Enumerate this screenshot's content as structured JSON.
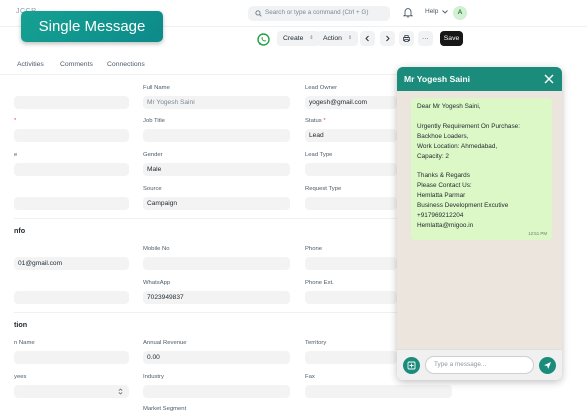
{
  "navbar": {
    "logo_text": "JCCR",
    "search_placeholder": "Search or type a command (Ctrl + G)",
    "help_label": "Help",
    "avatar_initial": "A"
  },
  "badge": {
    "label": "Single Message"
  },
  "toolbar": {
    "create_label": "Create",
    "action_label": "Action",
    "more_label": "···",
    "save_label": "Save"
  },
  "tabs": [
    "Activities",
    "Comments",
    "Connections"
  ],
  "form": {
    "row1": {
      "full_name_label": "Full Name",
      "full_name_value": "Mr Yogesh Saini",
      "lead_owner_label": "Lead Owner",
      "lead_owner_value": "yogesh@gmail.com"
    },
    "row2": {
      "left_label_tail": "*",
      "job_title_label": "Job Title",
      "status_label": "Status",
      "status_value": "Lead"
    },
    "row3": {
      "left_label_tail": "e",
      "gender_label": "Gender",
      "gender_value": "Male",
      "lead_type_label": "Lead Type"
    },
    "row4": {
      "source_label": "Source",
      "source_value": "Campaign",
      "request_type_label": "Request Type"
    },
    "contact_section": "nfo",
    "row5": {
      "email_value": "01@gmail.com",
      "mobile_label": "Mobile No",
      "phone_label": "Phone"
    },
    "row6": {
      "whatsapp_label": "WhatsApp",
      "whatsapp_value": "7023949837",
      "phone_ext_label": "Phone Ext."
    },
    "org_section": "tion",
    "row7": {
      "left_label_tail": "n Name",
      "annual_revenue_label": "Annual Revenue",
      "annual_revenue_value": "0.00",
      "territory_label": "Territory"
    },
    "row8": {
      "left_label_tail": "yees",
      "industry_label": "Industry",
      "fax_label": "Fax"
    },
    "row9": {
      "market_segment_label": "Market Segment"
    }
  },
  "chat": {
    "title": "Mr Yogesh Saini",
    "message_lines": [
      "Dear  Mr Yogesh Saini,",
      "",
      "Urgently Requirement On Purchase:",
      "Backhoe Loaders,",
      "Work Location: Ahmedabad,",
      "Capacity: 2",
      "",
      "Thanks & Regards",
      "Please Contact Us:",
      "Hemlatta Parmar",
      "Business Development Excutive",
      "+917969212204",
      "Hemlatta@migoo.in"
    ],
    "time": "12:51 PM",
    "input_placeholder": "Type a message..."
  },
  "colors": {
    "chat_header": "#1b8c7c",
    "chat_background": "#ece5dd",
    "bubble": "#dcf8c6",
    "badge": "#15a192",
    "save_button": "#171717"
  },
  "icons": [
    "search-icon",
    "bell-icon",
    "chevron-down-icon",
    "whatsapp-icon",
    "chevron-left-icon",
    "chevron-right-icon",
    "printer-icon",
    "close-icon",
    "attach-icon",
    "send-icon"
  ]
}
